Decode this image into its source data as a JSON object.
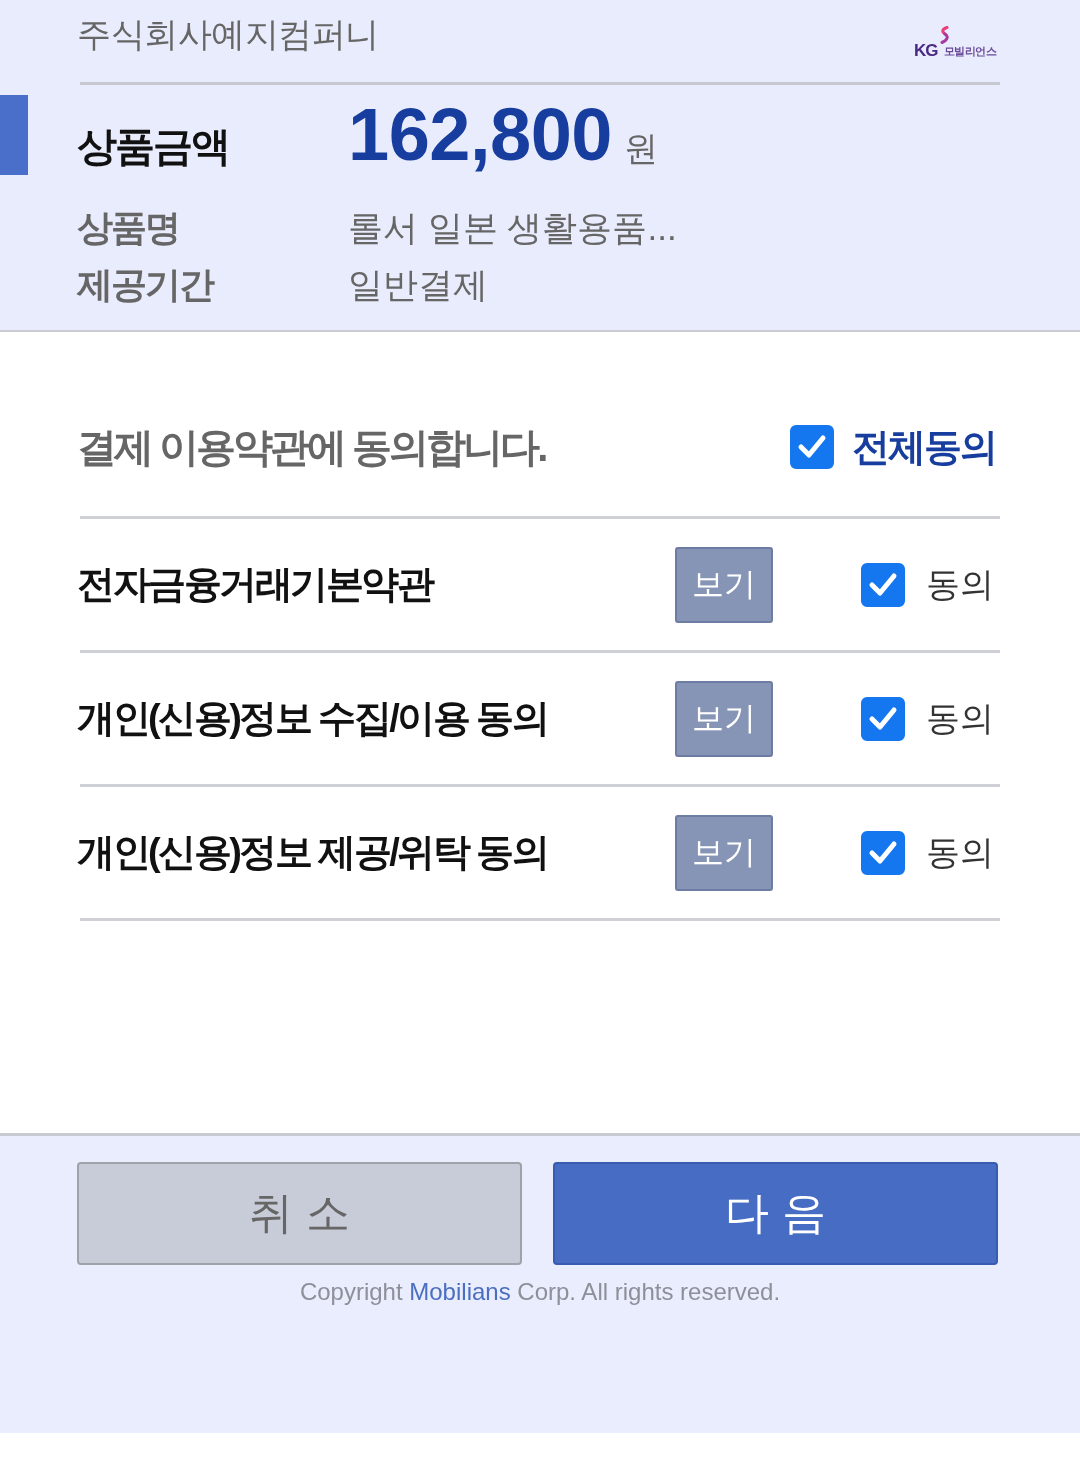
{
  "header": {
    "company": "주식회사예지컴퍼니",
    "logo": {
      "mark": "KG",
      "name": "모빌리언스"
    }
  },
  "amount": {
    "label": "상품금액",
    "value": "162,800",
    "unit": "원"
  },
  "details": [
    {
      "label": "상품명",
      "value": "롤서 일본 생활용품..."
    },
    {
      "label": "제공기간",
      "value": "일반결제"
    }
  ],
  "agreement": {
    "title": "결제 이용약관에 동의합니다.",
    "agree_all": {
      "label": "전체동의",
      "checked": true
    }
  },
  "terms": [
    {
      "title": "전자금융거래기본약관",
      "view_button": "보기",
      "agree_label": "동의",
      "checked": true
    },
    {
      "title": "개인(신용)정보 수집/이용 동의",
      "view_button": "보기",
      "agree_label": "동의",
      "checked": true
    },
    {
      "title": "개인(신용)정보 제공/위탁 동의",
      "view_button": "보기",
      "agree_label": "동의",
      "checked": true
    }
  ],
  "buttons": [
    {
      "label": "취 소",
      "kind": "cancel"
    },
    {
      "label": "다 음",
      "kind": "primary"
    }
  ],
  "copyright": {
    "before": "Copyright",
    "highlight": "Mobilians",
    "after": "Corp. All rights reserved."
  }
}
